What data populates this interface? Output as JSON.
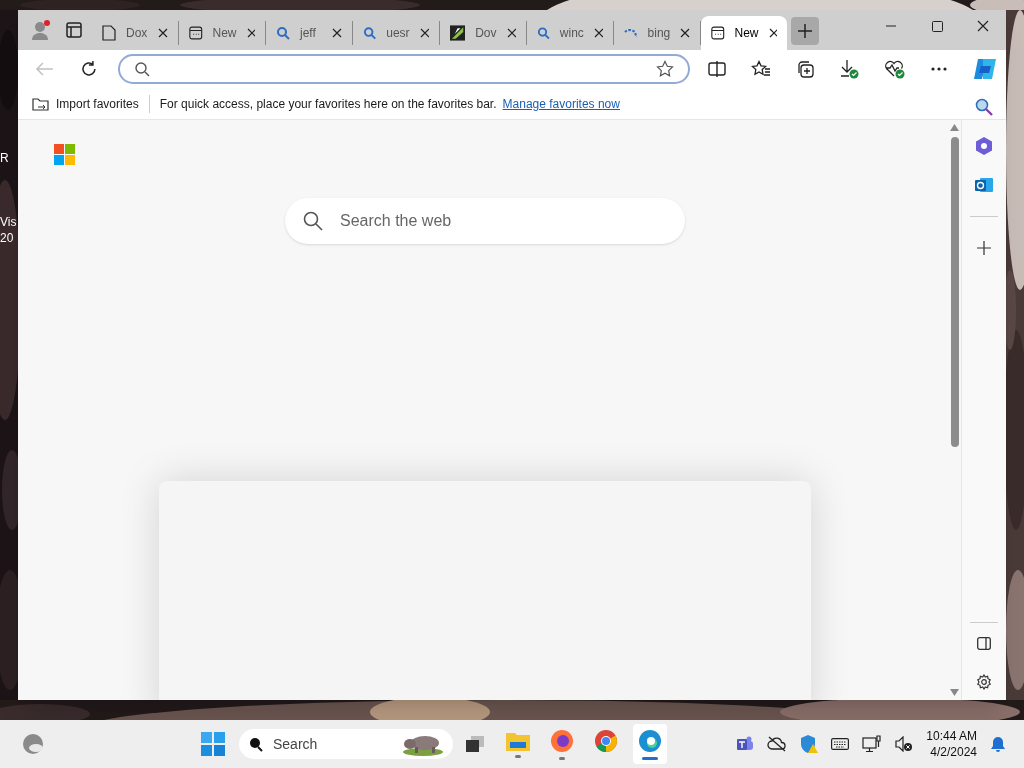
{
  "desktop_icons": [
    {
      "lines": [
        "R"
      ]
    },
    {
      "lines": [
        "Vis",
        "20"
      ]
    }
  ],
  "browser": {
    "tabs": [
      {
        "label": "Dox",
        "kind": "page",
        "selected": false
      },
      {
        "label": "New",
        "kind": "news",
        "selected": false
      },
      {
        "label": "jeff",
        "kind": "search",
        "selected": false
      },
      {
        "label": "uesr",
        "kind": "search",
        "selected": false
      },
      {
        "label": "Dov",
        "kind": "site",
        "selected": false
      },
      {
        "label": "winc",
        "kind": "search",
        "selected": false
      },
      {
        "label": "bing",
        "kind": "loading",
        "selected": false
      },
      {
        "label": "New",
        "kind": "news",
        "selected": true
      }
    ],
    "favorites_bar": {
      "import_label": "Import favorites",
      "message": "For quick access, place your favorites here on the favorites bar.",
      "link": "Manage favorites now"
    },
    "new_tab_page": {
      "search": {
        "placeholder": "Search the web"
      }
    }
  },
  "taskbar": {
    "search": {
      "placeholder": "Search"
    },
    "apps": [
      {
        "kind": "files",
        "running": true,
        "selected": false
      },
      {
        "kind": "firefox",
        "running": true,
        "selected": false
      },
      {
        "kind": "chrome",
        "running": false,
        "selected": false
      },
      {
        "kind": "edge",
        "running": true,
        "selected": true
      }
    ],
    "clock": {
      "time": "10:44 AM",
      "date": "4/2/2024"
    }
  }
}
